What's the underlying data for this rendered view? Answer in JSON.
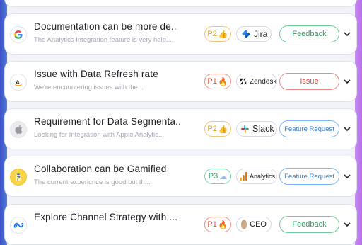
{
  "items": [
    {
      "title": "Documentation can be more de..",
      "subtitle": "The Analytics Integration feature is very help....",
      "priority": "P2",
      "priority_icon": "thumbs-up-icon",
      "source": "Jira",
      "source_icon": "jira-icon",
      "tag": "Feedback",
      "logo": "google-icon"
    },
    {
      "title": "Issue with Data Refresh rate",
      "subtitle": "We're encountering issues with the...",
      "priority": "P1",
      "priority_icon": "fire-icon",
      "source": "Zendesk",
      "source_icon": "zendesk-icon",
      "tag": "Issue",
      "logo": "amazon-icon"
    },
    {
      "title": "Requirement for Data Segmenta..",
      "subtitle": "Looking for Integration with Apple Analytic...",
      "priority": "P2",
      "priority_icon": "thumbs-up-icon",
      "source": "Slack",
      "source_icon": "slack-icon",
      "tag": "Feature Request",
      "logo": "apple-icon"
    },
    {
      "title": "Collaboration can be Gamified",
      "subtitle": "The current expericnce is good but th...",
      "priority": "P3",
      "priority_icon": "cloud-icon",
      "source": "Analytics",
      "source_icon": "analytics-icon",
      "tag": "Feature Request",
      "logo": "flipkart-icon"
    },
    {
      "title": "Explore Channel Strategy with ...",
      "subtitle": "",
      "priority": "P1",
      "priority_icon": "fire-icon",
      "source": "CEO",
      "source_icon": "avatar-icon",
      "tag": "Feedback",
      "logo": "meta-icon"
    }
  ],
  "colors": {
    "p1": "#e4473a",
    "p2": "#e4a21c",
    "p3": "#2ea063",
    "feedback": "#2ea063",
    "issue": "#e04545",
    "feature": "#2f7fd1"
  }
}
